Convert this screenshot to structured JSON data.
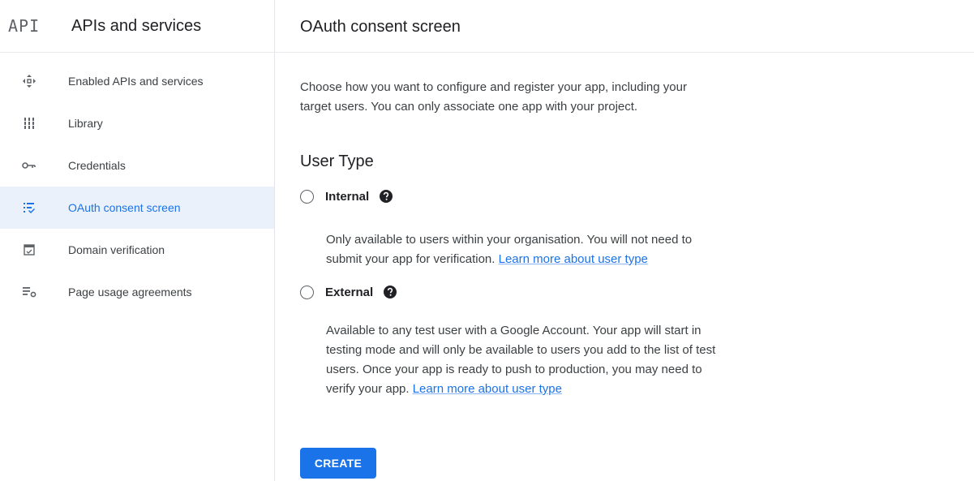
{
  "sidebar": {
    "logo_text": "API",
    "title": "APIs and services",
    "items": [
      {
        "label": "Enabled APIs and services",
        "icon": "enabled-apis-icon"
      },
      {
        "label": "Library",
        "icon": "library-icon"
      },
      {
        "label": "Credentials",
        "icon": "key-icon"
      },
      {
        "label": "OAuth consent screen",
        "icon": "consent-screen-icon",
        "active": true
      },
      {
        "label": "Domain verification",
        "icon": "domain-verification-icon"
      },
      {
        "label": "Page usage agreements",
        "icon": "settings-list-icon"
      }
    ]
  },
  "header": {
    "title": "OAuth consent screen"
  },
  "main": {
    "intro_line1": "Choose how you want to configure and register your app, including your",
    "intro_line2": "target users. You can only associate one app with your project.",
    "section_title": "User Type",
    "options": [
      {
        "label": "Internal",
        "selected": false,
        "desc_line1": "Only available to users within your organisation. You will not need to",
        "desc_line2": "submit your app for verification.",
        "link_text": "Learn more about user type"
      },
      {
        "label": "External",
        "selected": false,
        "desc_line1": "Available to any test user with a Google Account. Your app will start in",
        "desc_line2": "testing mode and will only be available to users you add to the list of test",
        "desc_line3": "users. Once your app is ready to push to production, you may need to",
        "desc_line4": "verify your app.",
        "link_text": "Learn more about user type"
      }
    ],
    "create_label": "CREATE"
  },
  "colors": {
    "accent": "#1a73e8",
    "active_bg": "#eaf1fb",
    "text": "#202124",
    "muted": "#5f6368"
  }
}
